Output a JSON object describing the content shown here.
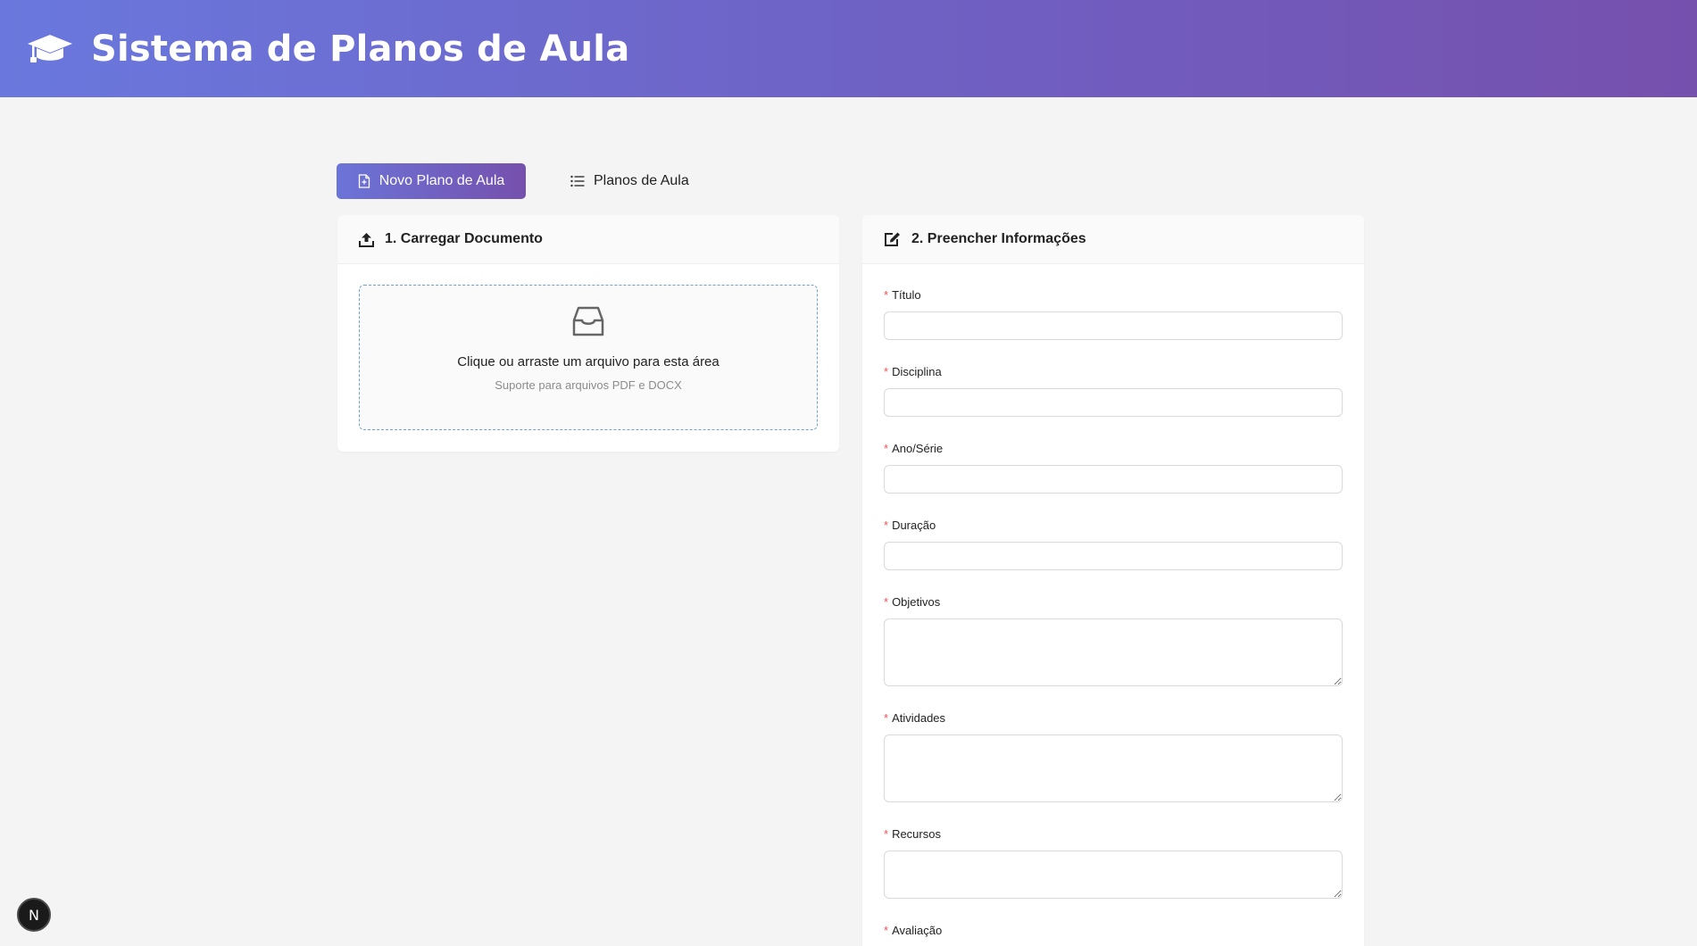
{
  "header": {
    "title": "Sistema de Planos de Aula",
    "logo_icon": "graduation-cap-icon"
  },
  "tabs": [
    {
      "label": "Novo Plano de Aula",
      "icon": "file-add-icon",
      "active": true
    },
    {
      "label": "Planos de Aula",
      "icon": "list-icon",
      "active": false
    }
  ],
  "upload": {
    "title": "1. Carregar Documento",
    "icon": "upload-icon",
    "dropzone_text": "Clique ou arraste um arquivo para esta área",
    "dropzone_hint": "Suporte para arquivos PDF e DOCX"
  },
  "form": {
    "title": "2. Preencher Informações",
    "icon": "edit-icon",
    "required_mark": "*",
    "fields": [
      {
        "label": "Título",
        "value": ""
      },
      {
        "label": "Disciplina",
        "value": ""
      },
      {
        "label": "Ano/Série",
        "value": ""
      },
      {
        "label": "Duração",
        "value": ""
      },
      {
        "label": "Objetivos",
        "value": ""
      },
      {
        "label": "Atividades",
        "value": ""
      },
      {
        "label": "Recursos",
        "value": ""
      },
      {
        "label": "Avaliação",
        "value": ""
      }
    ]
  },
  "dev_badge": {
    "label": "N"
  },
  "colors": {
    "accent_start": "#6a78dd",
    "accent_end": "#7650ad",
    "required": "#ff4d4f",
    "dropzone_border": "#6fa0d8"
  }
}
